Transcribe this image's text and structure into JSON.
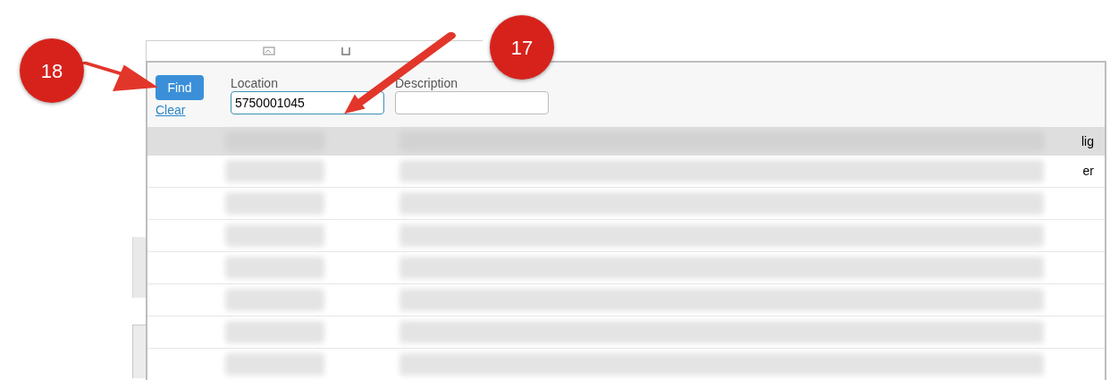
{
  "callouts": [
    {
      "number": "18"
    },
    {
      "number": "17"
    }
  ],
  "filter": {
    "find_button": "Find",
    "clear_link": "Clear",
    "location": {
      "label": "Location",
      "value": "5750001045"
    },
    "description": {
      "label": "Description"
    }
  },
  "table": {
    "rows": [
      {
        "kind": "header",
        "column_5": "lig"
      },
      {
        "kind": "data",
        "column_5": "er"
      },
      {
        "kind": "data"
      },
      {
        "kind": "data"
      },
      {
        "kind": "data"
      },
      {
        "kind": "data"
      },
      {
        "kind": "data"
      },
      {
        "kind": "data"
      }
    ]
  }
}
